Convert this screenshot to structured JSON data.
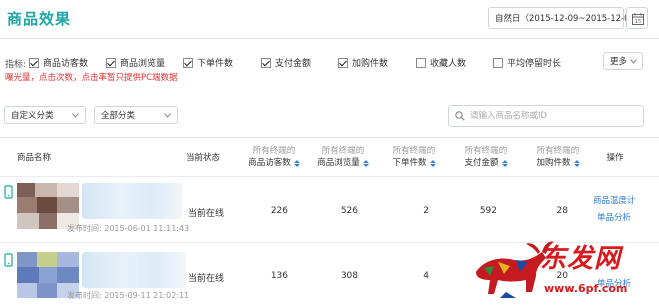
{
  "header": {
    "title": "商品效果",
    "date_range": "自然日（2015-12-09~2015-12-09）",
    "calendar_label": "15"
  },
  "metrics": {
    "label": "指标:",
    "items": [
      {
        "label": "商品访客数",
        "checked": true
      },
      {
        "label": "商品浏览量",
        "checked": true
      },
      {
        "label": "下单件数",
        "checked": true
      },
      {
        "label": "支付金额",
        "checked": true
      },
      {
        "label": "加购件数",
        "checked": true
      },
      {
        "label": "收藏人数",
        "checked": false
      },
      {
        "label": "平均停留时长",
        "checked": false
      }
    ],
    "more_label": "更多",
    "warning": "曝光量，点击次数，点击率暂只提供PC端数据"
  },
  "filters": {
    "custom_category": "自定义分类",
    "all_category": "全部分类",
    "search_placeholder": "请输入商品名称或ID"
  },
  "table": {
    "headers": {
      "name": "商品名称",
      "status": "当前状态",
      "all_terminals": "所有终端的",
      "visitors": "商品访客数",
      "views": "商品浏览量",
      "orders": "下单件数",
      "payment": "支付金额",
      "cart": "加购件数",
      "actions": "操作"
    },
    "rows": [
      {
        "publish_time": "发布时间: 2015-06-01 11:11:43",
        "status": "当前在线",
        "visitors": "226",
        "views": "526",
        "orders": "2",
        "payment": "592",
        "cart": "28",
        "actions": [
          "商品温度计",
          "单品分析"
        ]
      },
      {
        "publish_time": "发布时间: 2015-09-11 21:02:11",
        "status": "当前在线",
        "visitors": "136",
        "views": "308",
        "orders": "4",
        "payment": "",
        "cart": "20",
        "actions": [
          "单品分析"
        ]
      }
    ]
  },
  "watermark": {
    "text": "东发网",
    "url": "www.6pf.com"
  },
  "colors": {
    "title": "#1fa6a6",
    "warning": "#e53333",
    "link": "#2a7ad4",
    "sort_arrow": "#3a86d4",
    "watermark": "#d8191e"
  }
}
